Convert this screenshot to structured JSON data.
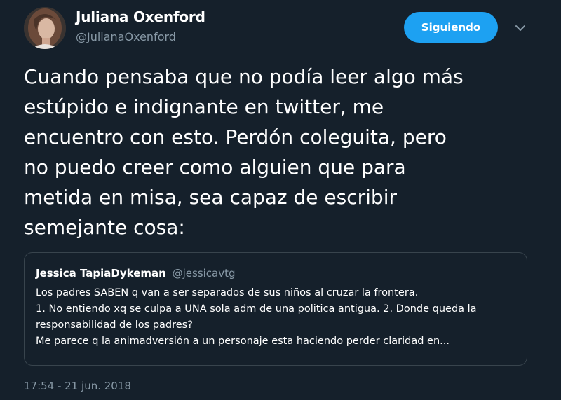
{
  "author": {
    "display_name": "Juliana Oxenford",
    "handle": "@JulianaOxenford",
    "avatar_icon": "avatar-photo"
  },
  "follow_button": {
    "label": "Siguiendo",
    "color": "#1da1f2"
  },
  "menu_icon": "chevron-down-icon",
  "tweet": {
    "text": "Cuando pensaba que no podía leer algo más\nestúpido e indignante en twitter, me\nencuentro con esto. Perdón coleguita, pero\nno puedo creer como alguien que para\nmetida en misa, sea capaz de escribir\nsemejante cosa:",
    "timestamp": "17:54 - 21 jun. 2018"
  },
  "quoted_tweet": {
    "display_name": "Jessica TapiaDykeman",
    "handle": "@jessicavtg",
    "text": "Los padres SABEN q van a ser separados de sus niños al cruzar la frontera.\n1. No entiendo xq se culpa a UNA sola adm de una politica antigua. 2. Donde queda la\nresponsabilidad de los padres?\nMe parece q la animadversión a un personaje esta haciendo perder claridad en..."
  },
  "colors": {
    "background": "#15202b",
    "text_primary": "#ffffff",
    "text_secondary": "#8899a6",
    "border": "#38444d"
  }
}
